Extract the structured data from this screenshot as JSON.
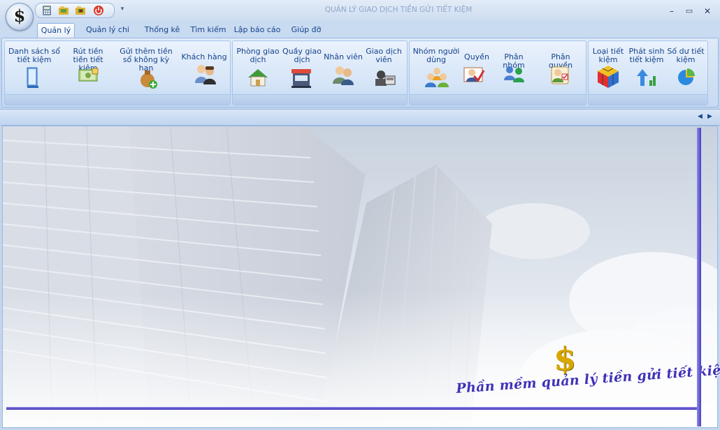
{
  "window": {
    "title": "QUẢN LÝ GIAO DỊCH TIỀN GỬI TIẾT KIỆM",
    "orb_symbol": "$",
    "qat_customize": "▾",
    "minimize": "–",
    "maximize": "▭",
    "close": "✕"
  },
  "tabs": [
    {
      "label": "Quản lý",
      "active": true
    },
    {
      "label": "Quản lý chi tiết"
    },
    {
      "label": "Thống kê"
    },
    {
      "label": "Tìm kiếm"
    },
    {
      "label": "Lập báo cáo"
    },
    {
      "label": "Giúp đỡ"
    }
  ],
  "ribbon": {
    "group1": [
      {
        "label": "Danh sách sổ tiết kiệm",
        "icon": "book-icon"
      },
      {
        "label": "Rút tiền tiền tiết kiệm",
        "icon": "money-icon"
      },
      {
        "label": "Gửi thêm tiền sổ không kỳ hạn",
        "icon": "add-money-icon"
      },
      {
        "label": "Khách hàng",
        "icon": "customers-icon"
      }
    ],
    "group2": [
      {
        "label": "Phòng giao dịch",
        "icon": "house-icon"
      },
      {
        "label": "Quầy giao dịch",
        "icon": "counter-icon"
      },
      {
        "label": "Nhân viên",
        "icon": "staff-icon"
      },
      {
        "label": "Giao dịch viên",
        "icon": "teller-icon"
      }
    ],
    "group3": [
      {
        "label": "Nhóm người dùng",
        "icon": "user-group-icon"
      },
      {
        "label": "Quyền",
        "icon": "permission-icon"
      },
      {
        "label": "Phân nhóm",
        "icon": "assign-group-icon"
      },
      {
        "label": "Phân quyền",
        "icon": "assign-permission-icon"
      }
    ],
    "group4": [
      {
        "label": "Loại tiết kiệm",
        "icon": "cube-icon"
      },
      {
        "label": "Phát sinh tiết kiệm",
        "icon": "growth-icon"
      },
      {
        "label": "Số dư tiết kiệm",
        "icon": "pie-chart-icon"
      }
    ]
  },
  "collapse_bar": {
    "left_arrow": "◀",
    "right_arrow": "▶"
  },
  "main": {
    "slogan": "Phần mềm quản lý tiền gửi tiết kiệm",
    "logo_symbol": "$"
  }
}
